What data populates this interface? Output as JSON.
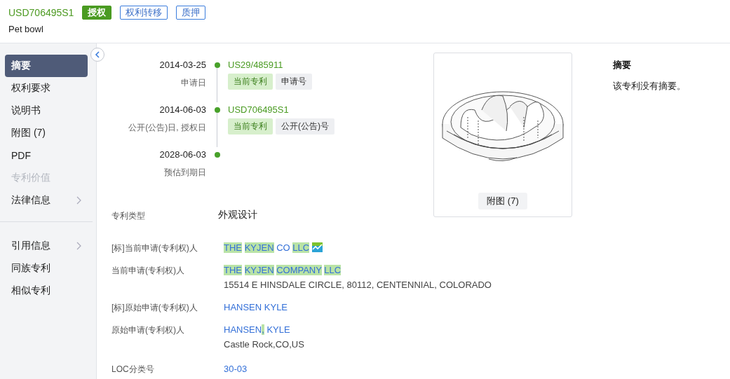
{
  "header": {
    "number": "USD706495S1",
    "badges": [
      {
        "label": "授权",
        "kind": "solid"
      },
      {
        "label": "权利转移",
        "kind": "outline"
      },
      {
        "label": "质押",
        "kind": "outline"
      }
    ],
    "title": "Pet bowl"
  },
  "sidebar": {
    "groups": [
      [
        {
          "label": "摘要",
          "selected": true,
          "disabled": false,
          "expandable": false
        },
        {
          "label": "权利要求",
          "selected": false,
          "disabled": false,
          "expandable": false
        },
        {
          "label": "说明书",
          "selected": false,
          "disabled": false,
          "expandable": false
        },
        {
          "label": "附图 (7)",
          "selected": false,
          "disabled": false,
          "expandable": false
        },
        {
          "label": "PDF",
          "selected": false,
          "disabled": false,
          "expandable": false
        },
        {
          "label": "专利价值",
          "selected": false,
          "disabled": true,
          "expandable": false
        },
        {
          "label": "法律信息",
          "selected": false,
          "disabled": false,
          "expandable": true
        }
      ],
      [
        {
          "label": "引用信息",
          "selected": false,
          "disabled": false,
          "expandable": true
        },
        {
          "label": "同族专利",
          "selected": false,
          "disabled": false,
          "expandable": false
        },
        {
          "label": "相似专利",
          "selected": false,
          "disabled": false,
          "expandable": false
        }
      ]
    ]
  },
  "timeline": [
    {
      "date": "2014-03-25",
      "label": "申请日",
      "link": "US29/485911",
      "tags": [
        {
          "label": "当前专利",
          "kind": "current"
        },
        {
          "label": "申请号",
          "kind": "plain"
        }
      ]
    },
    {
      "date": "2014-06-03",
      "label": "公开(公告)日, 授权日",
      "link": "USD706495S1",
      "tags": [
        {
          "label": "当前专利",
          "kind": "current"
        },
        {
          "label": "公开(公告)号",
          "kind": "plain"
        }
      ]
    },
    {
      "date": "2028-06-03",
      "label": "预估到期日"
    }
  ],
  "figure": {
    "kind": "picture",
    "caption": "附图 (7)"
  },
  "abstract": {
    "title": "摘要",
    "text": "该专利没有摘要。"
  },
  "patent_type": {
    "label": "专利类型",
    "value": "外观设计"
  },
  "fields": [
    {
      "label": "[标]当前申请(专利权)人",
      "lines": [
        {
          "kind": "link",
          "trend_icon": true,
          "parts": [
            {
              "text": "THE",
              "highlighted": true
            },
            {
              "text": " KYJEN",
              "highlighted": true
            },
            {
              "text": " CO",
              "highlighted": false
            },
            {
              "text": " LLC",
              "highlighted": true
            }
          ]
        }
      ]
    },
    {
      "label": "当前申请(专利权)人",
      "lines": [
        {
          "kind": "link",
          "parts": [
            {
              "text": "THE",
              "highlighted": true
            },
            {
              "text": " KYJEN",
              "highlighted": true
            },
            {
              "text": " COMPANY",
              "highlighted": true
            },
            {
              "text": " LLC",
              "highlighted": true
            }
          ]
        },
        {
          "kind": "text",
          "parts": [
            {
              "text": "15514 E HINSDALE CIRCLE, 80112, CENTENNIAL, COLORADO",
              "highlighted": false
            }
          ]
        }
      ]
    },
    {
      "label": "[标]原始申请(专利权)人",
      "lines": [
        {
          "kind": "link",
          "parts": [
            {
              "text": "HANSEN KYLE",
              "highlighted": false
            }
          ]
        }
      ]
    },
    {
      "label": "原始申请(专利权)人",
      "lines": [
        {
          "kind": "link",
          "parts": [
            {
              "text": "HANSEN",
              "highlighted": false
            },
            {
              "text": ",",
              "highlighted": true
            },
            {
              "text": " KYLE",
              "highlighted": false
            }
          ]
        },
        {
          "kind": "text",
          "parts": [
            {
              "text": "Castle Rock,CO,US",
              "highlighted": false
            }
          ]
        }
      ]
    },
    {
      "label": "LOC分类号",
      "lines": [
        {
          "kind": "link",
          "parts": [
            {
              "text": "30-03",
              "highlighted": false
            }
          ]
        }
      ]
    }
  ]
}
